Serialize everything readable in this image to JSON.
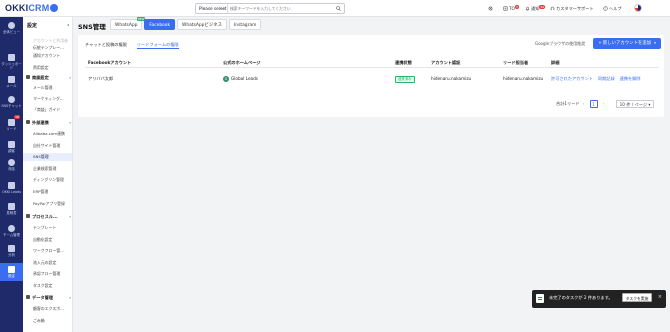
{
  "brand": {
    "name_main": "OKKI",
    "name_sub": "CRM"
  },
  "header": {
    "search_scope": "Please select",
    "search_placeholder": "検索キーワードを入力してください",
    "items": [
      {
        "id": "todo",
        "label": "TO",
        "badge": "3"
      },
      {
        "id": "notice",
        "label": "通知",
        "badge": "99"
      },
      {
        "id": "support",
        "label": "カスタマーサポート"
      },
      {
        "id": "help",
        "label": "ヘルプ"
      }
    ]
  },
  "rail": {
    "items": [
      {
        "id": "home",
        "label": "全体ビュー"
      },
      {
        "id": "dashboard",
        "label": "ダッシュボード"
      },
      {
        "id": "mail",
        "label": "メール"
      },
      {
        "id": "sns",
        "label": "SNSチャット"
      },
      {
        "id": "leads",
        "label": "リード",
        "badge": "16"
      },
      {
        "id": "customers",
        "label": "顧客"
      },
      {
        "id": "opportunity",
        "label": "商談"
      },
      {
        "id": "okki-leads",
        "label": "OKKI Leads"
      },
      {
        "id": "docs",
        "label": "見積書"
      },
      {
        "id": "team",
        "label": "チーム管理"
      },
      {
        "id": "analysis",
        "label": "分析"
      },
      {
        "id": "settings",
        "label": "設定"
      }
    ]
  },
  "sidebar": {
    "title": "設定",
    "items": [
      {
        "kind": "item",
        "label": "アカウントと利用者",
        "faded": true
      },
      {
        "kind": "item",
        "label": "伝統テンプレー..."
      },
      {
        "kind": "item",
        "label": "通知アカウント"
      },
      {
        "kind": "item",
        "label": "費用設定"
      },
      {
        "kind": "group",
        "label": "商談設定"
      },
      {
        "kind": "item",
        "label": "メール管理"
      },
      {
        "kind": "item",
        "label": "マーケティング..."
      },
      {
        "kind": "item",
        "label": "「商談」ガイド"
      },
      {
        "kind": "group",
        "label": "外部連携"
      },
      {
        "kind": "item",
        "label": "Alibaba.com連携"
      },
      {
        "kind": "item",
        "label": "自社サイト管理"
      },
      {
        "kind": "item",
        "label": "SNS管理",
        "active": true
      },
      {
        "kind": "item",
        "label": "企業検索管理"
      },
      {
        "kind": "item",
        "label": "ディングリン管理"
      },
      {
        "kind": "item",
        "label": "ERP管理"
      },
      {
        "kind": "item",
        "label": "PayPalアプリ登録"
      },
      {
        "kind": "group",
        "label": "プロセスル..."
      },
      {
        "kind": "item",
        "label": "テンプレート"
      },
      {
        "kind": "item",
        "label": "自動化設定"
      },
      {
        "kind": "item",
        "label": "ワークフロー管..."
      },
      {
        "kind": "item",
        "label": "流入元の設定"
      },
      {
        "kind": "item",
        "label": "承認フロー管理"
      },
      {
        "kind": "item",
        "label": "タスク設定"
      },
      {
        "kind": "group",
        "label": "データ管理"
      },
      {
        "kind": "item",
        "label": "顧客のエクスポ..."
      },
      {
        "kind": "item",
        "label": "ごみ箱"
      }
    ]
  },
  "main": {
    "page_title": "SNS管理",
    "platform_tabs": [
      {
        "label": "WhatsApp",
        "new_badge": "NEW"
      },
      {
        "label": "Facebook",
        "active": true
      },
      {
        "label": "WhatsAppビジネス"
      },
      {
        "label": "Instagram"
      }
    ],
    "sub_tabs": [
      {
        "label": "チャットと投稿の権限"
      },
      {
        "label": "リードフォームの権限",
        "active": true
      }
    ],
    "browser_note": "Googleブラウザの使用推奨",
    "add_button": "新しいアカウントを追加",
    "columns": [
      "Facebookアカウント",
      "公式のホームページ",
      "連携状態",
      "アカウント認証",
      "リード担当者",
      "詳細"
    ],
    "rows": [
      {
        "account": "アリババ太郎",
        "page_initial": "G",
        "page_name": "Global Leads",
        "status": "連携済み",
        "auth": "hidenaru.nakamizu",
        "owner": "hidenaru.nakamizu",
        "actions": [
          "許可されたアカウント",
          "同期記録",
          "連携を解除"
        ]
      }
    ],
    "pagination": {
      "total": "合計1リード",
      "current_page": "1",
      "page_size": "10 件 / ページ"
    }
  },
  "toast": {
    "message": "未完了のタスクが 2 件あります。",
    "button": "タスクを実施"
  },
  "colors": {
    "rail": "#1f2a6b",
    "accent": "#3a6df0",
    "success": "#2db36b",
    "badge": "#e53935"
  }
}
